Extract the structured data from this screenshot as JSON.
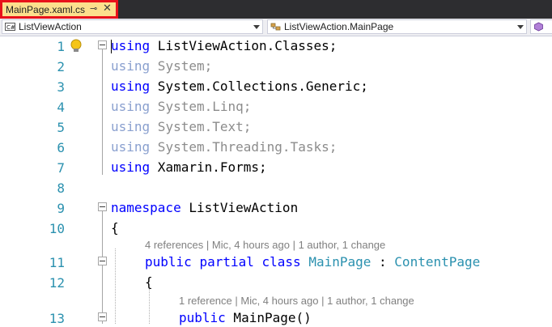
{
  "tab": {
    "title": "MainPage.xaml.cs",
    "pin_icon": "pin-icon",
    "close_icon": "close-icon"
  },
  "navbar": {
    "project_combo": "ListViewAction",
    "type_combo": "ListViewAction.MainPage",
    "member_combo": ""
  },
  "editor": {
    "line_numbers": [
      "1",
      "2",
      "3",
      "4",
      "5",
      "6",
      "7",
      "8",
      "9",
      "10",
      "11",
      "12",
      "13"
    ],
    "lines": {
      "l1": {
        "kw": "using",
        "rest": " ListViewAction.Classes;"
      },
      "l2": {
        "kw": "using",
        "rest": " System;"
      },
      "l3": {
        "kw": "using",
        "rest": " System.Collections.Generic;"
      },
      "l4": {
        "kw": "using",
        "rest": " System.Linq;"
      },
      "l5": {
        "kw": "using",
        "rest": " System.Text;"
      },
      "l6": {
        "kw": "using",
        "rest": " System.Threading.Tasks;"
      },
      "l7": {
        "kw": "using",
        "rest": " Xamarin.Forms;"
      },
      "l9": {
        "kw": "namespace",
        "rest": " ListViewAction"
      },
      "l10": {
        "text": "{"
      },
      "lens1": "4 references | Mic, 4 hours ago | 1 author, 1 change",
      "l11": {
        "kw1": "public",
        "kw2": "partial",
        "kw3": "class",
        "name": "MainPage",
        "sep": " : ",
        "base": "ContentPage"
      },
      "l12": {
        "text": "{"
      },
      "lens2": "1 reference | Mic, 4 hours ago | 1 author, 1 change",
      "l13": {
        "kw": "public",
        "rest": " MainPage()"
      }
    }
  }
}
